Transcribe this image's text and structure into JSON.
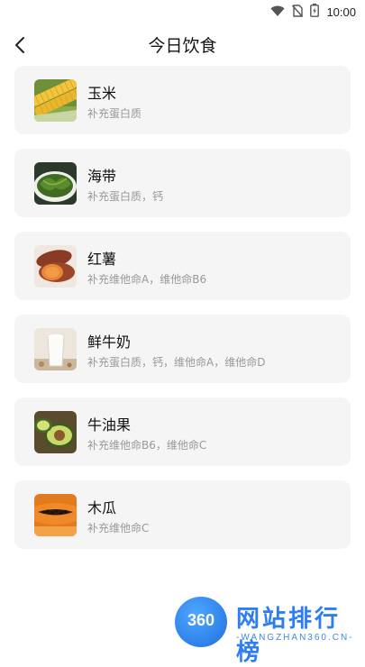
{
  "status_bar": {
    "time": "10:00",
    "icons": [
      "wifi-icon",
      "no-sim-icon",
      "battery-icon"
    ]
  },
  "header": {
    "title": "今日饮食",
    "back_icon": "back-arrow-icon"
  },
  "foods": [
    {
      "name": "玉米",
      "desc": "补充蛋白质",
      "image": "corn"
    },
    {
      "name": "海带",
      "desc": "补充蛋白质，钙",
      "image": "kelp"
    },
    {
      "name": "红薯",
      "desc": "补充维他命A，维他命B6",
      "image": "sweet-potato"
    },
    {
      "name": "鲜牛奶",
      "desc": "补充蛋白质，钙，维他命A，维他命D",
      "image": "milk"
    },
    {
      "name": "牛油果",
      "desc": "补充维他命B6，维他命C",
      "image": "avocado"
    },
    {
      "name": "木瓜",
      "desc": "补充维他命C",
      "image": "papaya"
    }
  ],
  "watermark": {
    "logo_text": "360",
    "site_name": "网站排行榜",
    "url": "-WANGZHAN360.CN-"
  },
  "colors": {
    "card_bg": "#f5f5f5",
    "desc_text": "#999999",
    "watermark_blue": "#2e7ef2"
  }
}
